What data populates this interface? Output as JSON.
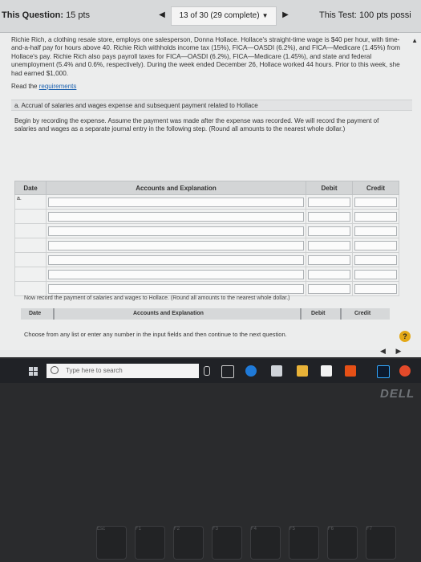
{
  "header": {
    "question_label": "This Question:",
    "question_points": "15 pts",
    "progress": "13 of 30 (29 complete)",
    "test_label": "This Test:",
    "test_points": "100 pts possi"
  },
  "problem_text": "Richie Rich, a clothing resale store, employs one salesperson, Donna Hollace. Hollace's straight-time wage is $40 per hour, with time-and-a-half pay for hours above 40. Richie Rich withholds income tax (15%), FICA—OASDI (6.2%), and FICA—Medicare (1.45%) from Hollace's pay. Richie Rich also pays payroll taxes for FICA—OASDI (6.2%), FICA—Medicare (1.45%), and state and federal unemployment (5.4% and 0.6%, respectively). During the week ended December 26, Hollace worked 44 hours. Prior to this week, she had earned $1,000.",
  "read_prefix": "Read the",
  "read_link": "requirements",
  "part_a": "a. Accrual of salaries and wages expense and subsequent payment related to Hollace",
  "instructions": "Begin by recording the expense. Assume the payment was made after the expense was recorded. We will record the payment of salaries and wages as a separate journal entry in the following step. (Round all amounts to the nearest whole dollar.)",
  "table": {
    "col_date": "Date",
    "col_accounts": "Accounts and Explanation",
    "col_debit": "Debit",
    "col_credit": "Credit",
    "first_row_date": "a."
  },
  "payment_note": "Now record the payment of salaries and wages to Hollace. (Round all amounts to the nearest whole dollar.)",
  "mini_table": {
    "col_date": "Date",
    "col_accounts": "Accounts and Explanation",
    "col_debit": "Debit",
    "col_credit": "Credit"
  },
  "choose_text": "Choose from any list or enter any number in the input fields and then continue to the next question.",
  "help_label": "?",
  "taskbar": {
    "search_placeholder": "Type here to search"
  },
  "brand": "DELL",
  "keys": [
    "Esc",
    "F1",
    "F2",
    "F3",
    "F4",
    "F5",
    "F6",
    "F7"
  ],
  "colors": {
    "link": "#1e63b0",
    "help_button": "#e3a817",
    "taskbar": "#202226"
  }
}
